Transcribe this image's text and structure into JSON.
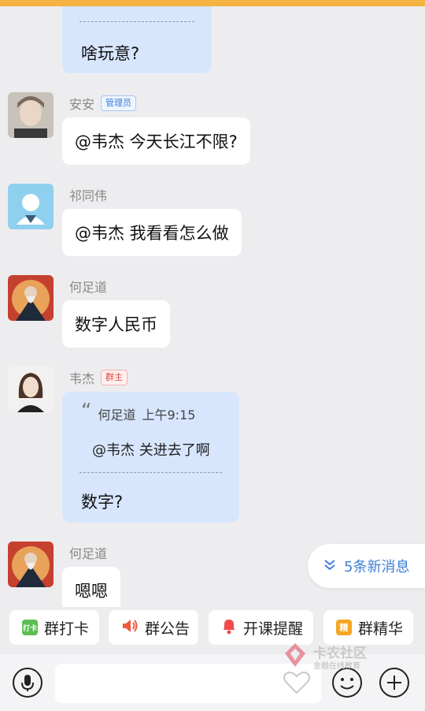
{
  "messages": [
    {
      "reply_text": "啥玩意?"
    },
    {
      "sender": "安安",
      "badge": "管理员",
      "text": "@韦杰 今天长江不限?"
    },
    {
      "sender": "祁同伟",
      "text": "@韦杰 我看看怎么做"
    },
    {
      "sender": "何足道",
      "text": "数字人民币"
    },
    {
      "sender": "韦杰",
      "badge": "群主",
      "quote_author": "何足道",
      "quote_time": "上午9:15",
      "quote_text": "@韦杰 关进去了啊",
      "reply_text": "数字?"
    },
    {
      "sender": "何足道",
      "text": "嗯嗯"
    }
  ],
  "new_messages": {
    "label": "5条新消息",
    "icon": "double-chevron-down-icon"
  },
  "quick_actions": [
    {
      "label": "群打卡",
      "icon": "checkin-icon",
      "icon_text": "打卡",
      "color": "#5bbf52"
    },
    {
      "label": "群公告",
      "icon": "speaker-icon",
      "color": "#f05a3c"
    },
    {
      "label": "开课提醒",
      "icon": "bell-icon",
      "color": "#f04b4b"
    },
    {
      "label": "群精华",
      "icon": "essence-icon",
      "icon_text": "精",
      "color": "#f5a623"
    }
  ],
  "input_bar": {
    "left_icon": "microphone-icon",
    "right_icons": [
      "emoji-icon",
      "plus-circle-icon"
    ],
    "favorite_icon": "heart-icon"
  },
  "watermark": {
    "title": "卡农社区",
    "subtitle": "金融在线教育"
  }
}
